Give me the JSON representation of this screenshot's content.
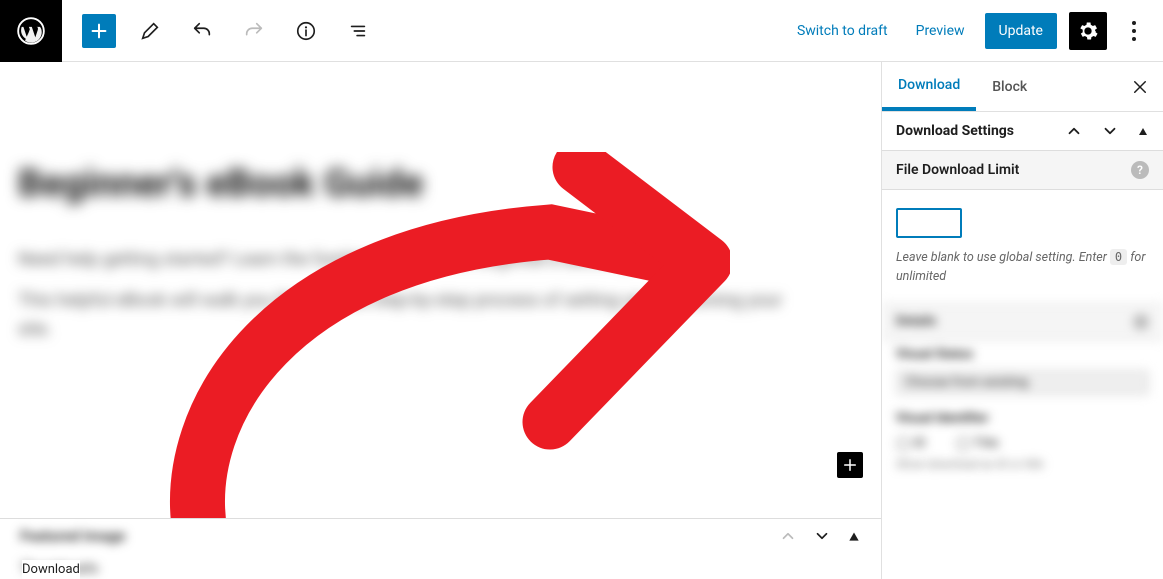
{
  "topbar": {
    "switch_draft": "Switch to draft",
    "preview": "Preview",
    "update": "Update"
  },
  "editor": {
    "blur_title": "Beginner's eBook Guide",
    "blur_p1": "Need help getting started? Learn the fundamentals in our beginner's eBook guide.",
    "blur_p2": "This helpful eBook will walk you through the step-by-step process of setting up and running your site.",
    "meta_label": "Featured Image",
    "meta_row2": "Thumbnails"
  },
  "tooltip": "Download",
  "sidebar": {
    "tabs": {
      "download": "Download",
      "block": "Block"
    },
    "section_title": "Download Settings",
    "fdl_title": "File Download Limit",
    "help_text_prefix": "Leave blank to use global setting. Enter ",
    "help_code": "0",
    "help_text_suffix": " for unlimited",
    "blur": {
      "details_head": "Details",
      "tags_head": "Visual Status",
      "tag_chip": "Choose from existing",
      "cat_head": "Visual Identifier",
      "opt_a": "ID",
      "opt_b": "Title",
      "desc": "Show download as ID or title"
    }
  }
}
